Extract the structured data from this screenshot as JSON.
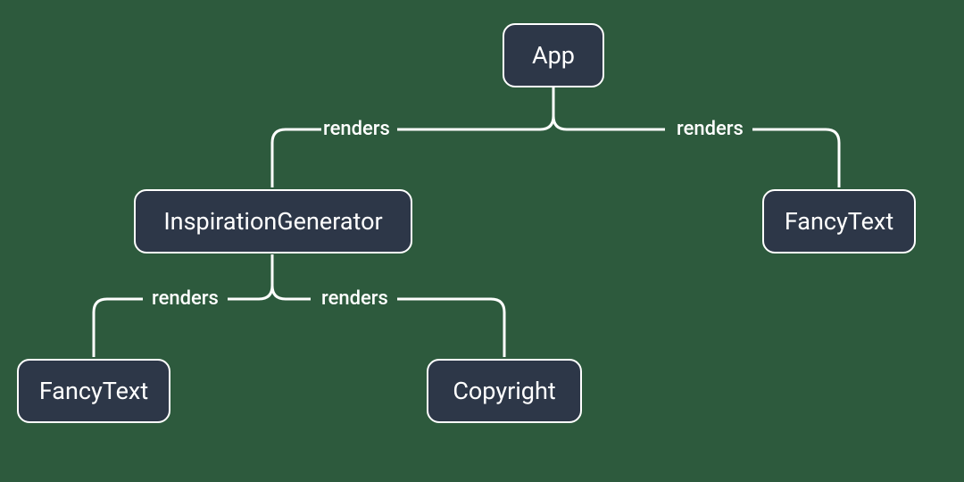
{
  "diagram": {
    "nodes": {
      "app": {
        "label": "App"
      },
      "inspiration_generator": {
        "label": "InspirationGenerator"
      },
      "fancy_text_right": {
        "label": "FancyText"
      },
      "fancy_text_left": {
        "label": "FancyText"
      },
      "copyright": {
        "label": "Copyright"
      }
    },
    "edges": {
      "app_to_inspiration": {
        "label": "renders"
      },
      "app_to_fancytext": {
        "label": "renders"
      },
      "inspiration_to_fancytext": {
        "label": "renders"
      },
      "inspiration_to_copyright": {
        "label": "renders"
      }
    },
    "colors": {
      "node_bg": "#2d3748",
      "stroke": "#ffffff",
      "page_bg": "#2d5a3d"
    }
  }
}
